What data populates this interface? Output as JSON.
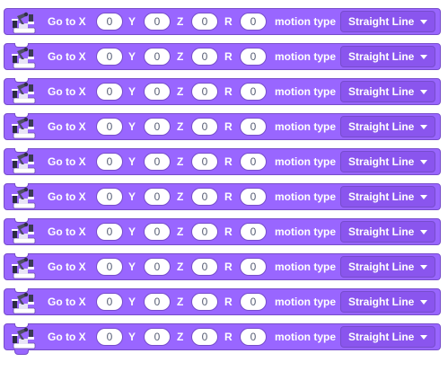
{
  "blocks": [
    {
      "goto_label": "Go to X",
      "x": "0",
      "y_label": "Y",
      "y": "0",
      "z_label": "Z",
      "z": "0",
      "r_label": "R",
      "r": "0",
      "motion_label": "motion type",
      "motion_type": "Straight Line",
      "icon": "robot-arm-icon"
    },
    {
      "goto_label": "Go to X",
      "x": "0",
      "y_label": "Y",
      "y": "0",
      "z_label": "Z",
      "z": "0",
      "r_label": "R",
      "r": "0",
      "motion_label": "motion type",
      "motion_type": "Straight Line",
      "icon": "robot-arm-icon"
    },
    {
      "goto_label": "Go to X",
      "x": "0",
      "y_label": "Y",
      "y": "0",
      "z_label": "Z",
      "z": "0",
      "r_label": "R",
      "r": "0",
      "motion_label": "motion type",
      "motion_type": "Straight Line",
      "icon": "robot-arm-icon"
    },
    {
      "goto_label": "Go to X",
      "x": "0",
      "y_label": "Y",
      "y": "0",
      "z_label": "Z",
      "z": "0",
      "r_label": "R",
      "r": "0",
      "motion_label": "motion type",
      "motion_type": "Straight Line",
      "icon": "robot-arm-icon"
    },
    {
      "goto_label": "Go to X",
      "x": "0",
      "y_label": "Y",
      "y": "0",
      "z_label": "Z",
      "z": "0",
      "r_label": "R",
      "r": "0",
      "motion_label": "motion type",
      "motion_type": "Straight Line",
      "icon": "robot-arm-icon"
    },
    {
      "goto_label": "Go to X",
      "x": "0",
      "y_label": "Y",
      "y": "0",
      "z_label": "Z",
      "z": "0",
      "r_label": "R",
      "r": "0",
      "motion_label": "motion type",
      "motion_type": "Straight Line",
      "icon": "robot-arm-icon"
    },
    {
      "goto_label": "Go to X",
      "x": "0",
      "y_label": "Y",
      "y": "0",
      "z_label": "Z",
      "z": "0",
      "r_label": "R",
      "r": "0",
      "motion_label": "motion type",
      "motion_type": "Straight Line",
      "icon": "robot-arm-icon"
    },
    {
      "goto_label": "Go to X",
      "x": "0",
      "y_label": "Y",
      "y": "0",
      "z_label": "Z",
      "z": "0",
      "r_label": "R",
      "r": "0",
      "motion_label": "motion type",
      "motion_type": "Straight Line",
      "icon": "robot-arm-icon"
    },
    {
      "goto_label": "Go to X",
      "x": "0",
      "y_label": "Y",
      "y": "0",
      "z_label": "Z",
      "z": "0",
      "r_label": "R",
      "r": "0",
      "motion_label": "motion type",
      "motion_type": "Straight Line",
      "icon": "robot-arm-icon"
    },
    {
      "goto_label": "Go to X",
      "x": "0",
      "y_label": "Y",
      "y": "0",
      "z_label": "Z",
      "z": "0",
      "r_label": "R",
      "r": "0",
      "motion_label": "motion type",
      "motion_type": "Straight Line",
      "icon": "robot-arm-icon"
    }
  ],
  "colors": {
    "block_fill": "#9966ff",
    "block_border": "#774dcb",
    "dropdown_fill": "#8a55ee",
    "input_text": "#575e75"
  }
}
